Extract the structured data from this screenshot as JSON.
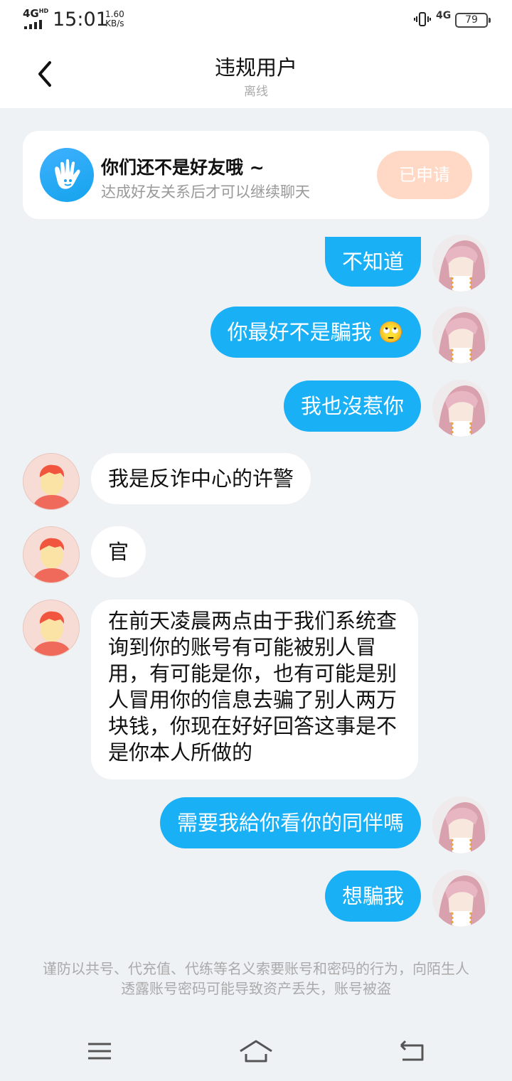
{
  "status_bar": {
    "network": "4G",
    "network_sup": "HD",
    "time": "15:01",
    "speed_value": "1.60",
    "speed_unit": "KB/s",
    "cell_type": "4G",
    "battery": "79"
  },
  "header": {
    "title": "违规用户",
    "status": "离线"
  },
  "friend_banner": {
    "title": "你们还不是好友哦 ~",
    "subtitle": "达成好友关系后才可以继续聊天",
    "button": "已申请"
  },
  "messages": [
    {
      "side": "out",
      "text": "不知道"
    },
    {
      "side": "out",
      "text": "你最好不是騙我 🙄"
    },
    {
      "side": "out",
      "text": "我也沒惹你"
    },
    {
      "side": "in",
      "text": "我是反诈中心的许警"
    },
    {
      "side": "in",
      "text": "官"
    },
    {
      "side": "in",
      "text": "在前天凌晨两点由于我们系统查询到你的账号有可能被别人冒用，有可能是你，也有可能是别人冒用你的信息去骗了别人两万块钱，你现在好好回答这事是不是你本人所做的"
    },
    {
      "side": "out",
      "text": "需要我給你看你的同伴嗎"
    },
    {
      "side": "out",
      "text": "想騙我"
    }
  ],
  "safety_note": "谨防以共号、代充值、代练等名义索要账号和密码的行为，向陌生人透露账号密码可能导致资产丢失，账号被盗",
  "icons": {
    "back": "chevron-left-icon",
    "friend": "hand-wave-icon",
    "menu": "menu-icon",
    "home": "home-icon",
    "return": "back-arrow-icon"
  },
  "colors": {
    "outgoing_bubble": "#1ab0f5",
    "incoming_bubble": "#ffffff",
    "background": "#eef2f5",
    "applied_button": "#ffd9c5"
  }
}
